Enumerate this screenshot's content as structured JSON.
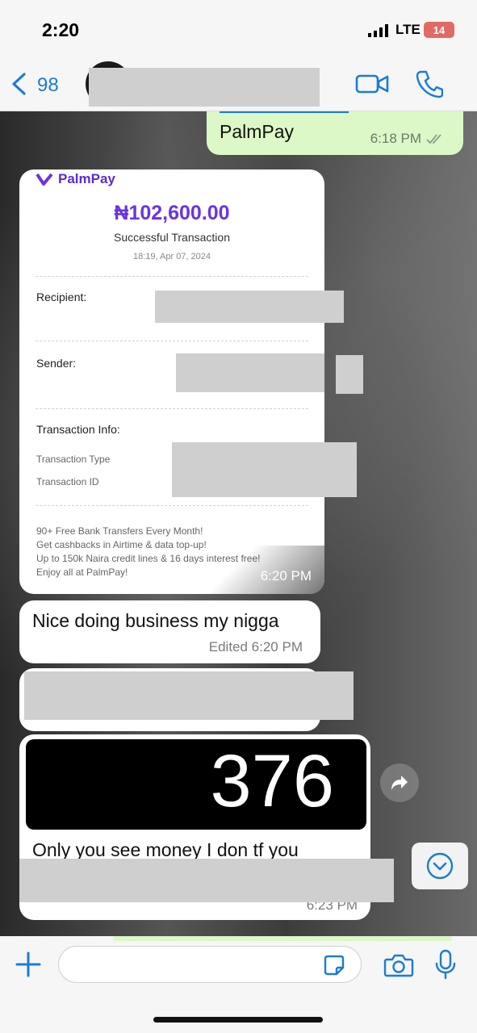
{
  "status_bar": {
    "time": "2:20",
    "network": "LTE",
    "battery": "14"
  },
  "header": {
    "back_count": "98"
  },
  "messages": {
    "outgoing_1": {
      "text": "PalmPay",
      "time": "6:18 PM"
    },
    "receipt": {
      "brand": "PalmPay",
      "amount": "₦102,600.00",
      "status": "Successful Transaction",
      "datetime": "18:19, Apr 07, 2024",
      "recipient_label": "Recipient:",
      "sender_label": "Sender:",
      "info_label": "Transaction Info:",
      "type_label": "Transaction Type",
      "id_label": "Transaction ID",
      "promo_lines": [
        "90+ Free Bank Transfers Every Month!",
        "Get cashbacks in Airtime & data top-up!",
        "Up to 150k Naira credit lines & 16 days interest free!",
        "Enjoy all at PalmPay!"
      ],
      "time": "6:20 PM"
    },
    "incoming_1": {
      "text": "Nice doing business my nigga",
      "time": "Edited 6:20 PM"
    },
    "image_message": {
      "number": "376",
      "caption": "Only you see money I don tf  you",
      "time": "6:23 PM"
    }
  },
  "composer": {
    "placeholder": ""
  }
}
